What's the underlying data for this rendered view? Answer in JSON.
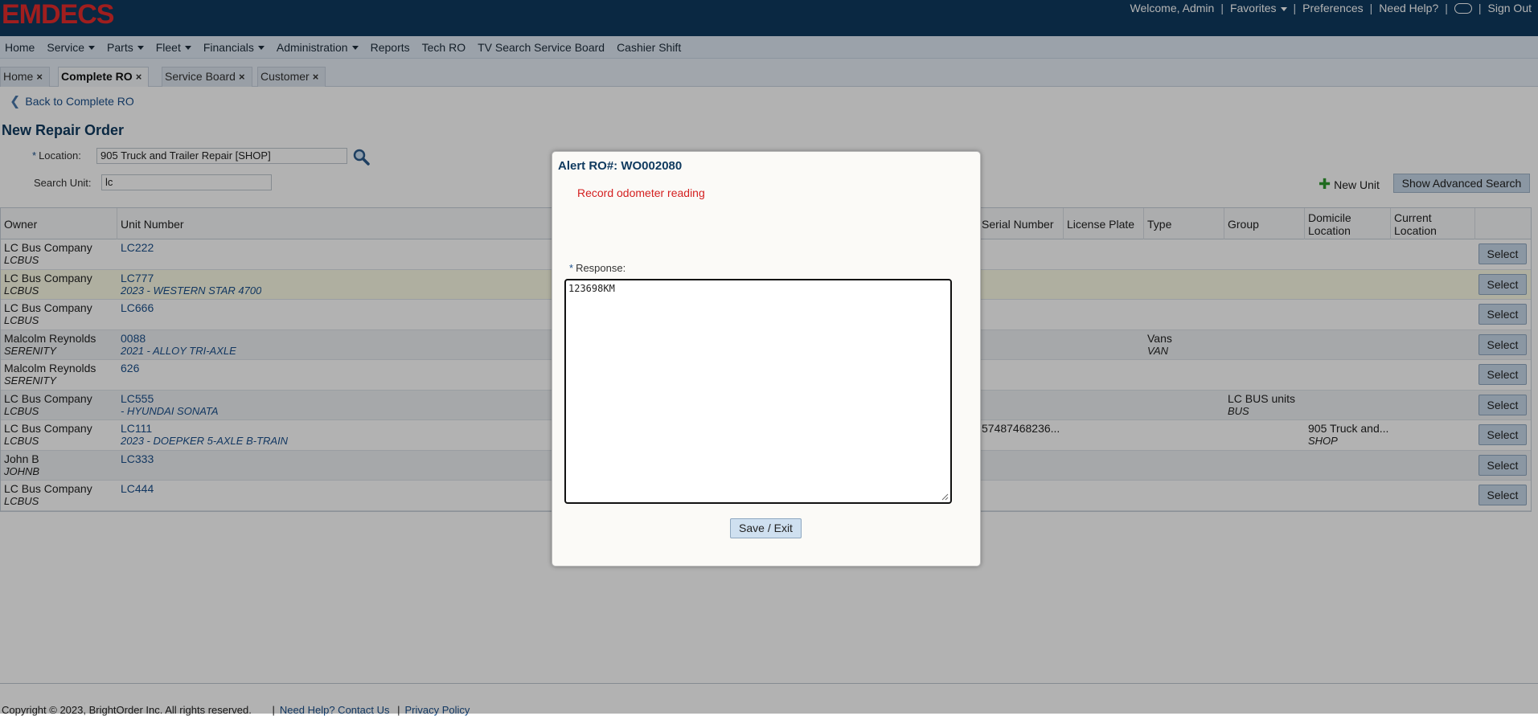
{
  "brand": {
    "logo_text": "EMDECS",
    "logo_color": "#e52b2b",
    "topbar_color": "#0f3a5f"
  },
  "topbar": {
    "welcome": "Welcome, Admin",
    "favorites": "Favorites",
    "preferences": "Preferences",
    "help": "Need Help?",
    "signout": "Sign Out"
  },
  "menu": [
    "Home",
    "Service",
    "Parts",
    "Fleet",
    "Financials",
    "Administration",
    "Reports",
    "Tech RO",
    "TV Search Service Board",
    "Cashier Shift"
  ],
  "tabs": [
    {
      "label": "Home",
      "active": false
    },
    {
      "label": "Complete RO",
      "active": true
    },
    {
      "label": "Service Board",
      "active": false
    },
    {
      "label": "Customer",
      "active": false
    }
  ],
  "page": {
    "back": "Back to Complete RO",
    "title": "New Repair Order",
    "location_label": "Location:",
    "location_value": "905 Truck and Trailer Repair [SHOP]",
    "search_label": "Search Unit:",
    "search_value": "lc",
    "new_unit": "New Unit",
    "advanced": "Show Advanced Search"
  },
  "table": {
    "headers": {
      "owner": "Owner",
      "unit": "Unit Number",
      "serial": "Serial Number",
      "plate": "License Plate",
      "type": "Type",
      "group": "Group",
      "domicile1": "Domicile",
      "domicile2": "Location",
      "current1": "Current",
      "current2": "Location"
    },
    "select_label": "Select",
    "rows": [
      {
        "owner": "LC Bus Company",
        "owner_code": "LCBUS",
        "unit": "LC222",
        "unit_desc": "",
        "serial": "",
        "type": "",
        "type_code": "",
        "group": "",
        "group_code": "",
        "domicile": "",
        "domicile_code": ""
      },
      {
        "owner": "LC Bus Company",
        "owner_code": "LCBUS",
        "unit": "LC777",
        "unit_desc": "2023 - WESTERN STAR 4700",
        "serial": "",
        "type": "",
        "type_code": "",
        "group": "",
        "group_code": "",
        "domicile": "",
        "domicile_code": ""
      },
      {
        "owner": "LC Bus Company",
        "owner_code": "LCBUS",
        "unit": "LC666",
        "unit_desc": "",
        "serial": "",
        "type": "",
        "type_code": "",
        "group": "",
        "group_code": "",
        "domicile": "",
        "domicile_code": ""
      },
      {
        "owner": "Malcolm Reynolds",
        "owner_code": "SERENITY",
        "unit": "0088",
        "unit_desc": "2021 - ALLOY TRI-AXLE",
        "serial": "",
        "type": "Vans",
        "type_code": "VAN",
        "group": "",
        "group_code": "",
        "domicile": "",
        "domicile_code": ""
      },
      {
        "owner": "Malcolm Reynolds",
        "owner_code": "SERENITY",
        "unit": "626",
        "unit_desc": "",
        "serial": "",
        "type": "",
        "type_code": "",
        "group": "",
        "group_code": "",
        "domicile": "",
        "domicile_code": ""
      },
      {
        "owner": "LC Bus Company",
        "owner_code": "LCBUS",
        "unit": "LC555",
        "unit_desc": "- HYUNDAI SONATA",
        "serial": "",
        "type": "",
        "type_code": "",
        "group": "LC BUS units",
        "group_code": "BUS",
        "domicile": "",
        "domicile_code": ""
      },
      {
        "owner": "LC Bus Company",
        "owner_code": "LCBUS",
        "unit": "LC111",
        "unit_desc": "2023 - DOEPKER 5-AXLE B-TRAIN",
        "serial": "57487468236...",
        "type": "",
        "type_code": "",
        "group": "",
        "group_code": "",
        "domicile": "905 Truck and...",
        "domicile_code": "SHOP"
      },
      {
        "owner": "John B",
        "owner_code": "JOHNB",
        "unit": "LC333",
        "unit_desc": "",
        "serial": "",
        "type": "",
        "type_code": "",
        "group": "",
        "group_code": "",
        "domicile": "",
        "domicile_code": ""
      },
      {
        "owner": "LC Bus Company",
        "owner_code": "LCBUS",
        "unit": "LC444",
        "unit_desc": "",
        "serial": "",
        "type": "",
        "type_code": "",
        "group": "",
        "group_code": "",
        "domicile": "",
        "domicile_code": ""
      }
    ]
  },
  "footer": {
    "copyright": "Copyright © 2023, BrightOrder Inc. All rights reserved.",
    "help": "Need Help? Contact Us",
    "privacy": "Privacy Policy"
  },
  "modal": {
    "title": "Alert RO#: WO002080",
    "alert": "Record odometer reading",
    "response_label": "Response:",
    "response_value": "123698KM",
    "save": "Save / Exit"
  }
}
